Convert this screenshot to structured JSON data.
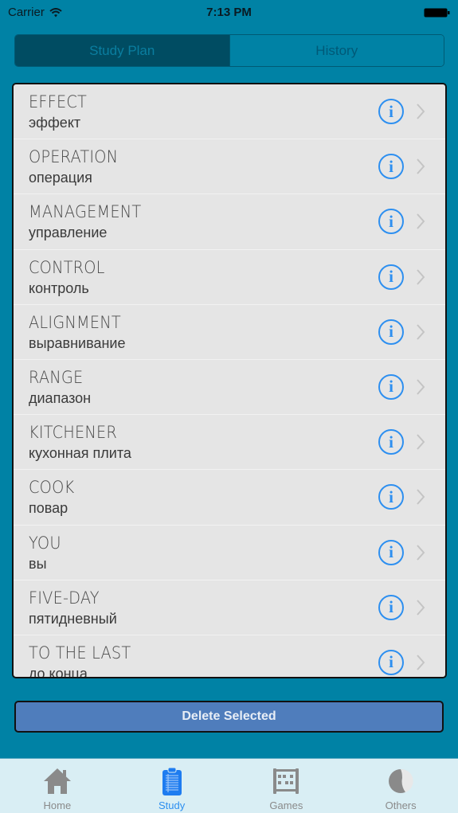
{
  "status_bar": {
    "carrier": "Carrier",
    "time": "7:13 PM",
    "wifi_icon": "wifi-icon",
    "battery_icon": "battery-icon"
  },
  "segmented_control": {
    "items": [
      {
        "label": "Study Plan",
        "selected": true
      },
      {
        "label": "History",
        "selected": false
      }
    ]
  },
  "word_list": {
    "items": [
      {
        "word": "EFFECT",
        "translation": "эффект"
      },
      {
        "word": "OPERATION",
        "translation": "операция"
      },
      {
        "word": "MANAGEMENT",
        "translation": "управление"
      },
      {
        "word": "CONTROL",
        "translation": "контроль"
      },
      {
        "word": "ALIGNMENT",
        "translation": "выравнивание"
      },
      {
        "word": "RANGE",
        "translation": "диапазон"
      },
      {
        "word": "KITCHENER",
        "translation": "кухонная плита"
      },
      {
        "word": "COOK",
        "translation": "повар"
      },
      {
        "word": "YOU",
        "translation": "вы"
      },
      {
        "word": "FIVE-DAY",
        "translation": "пятидневный"
      },
      {
        "word": "TO THE LAST",
        "translation": "до конца"
      }
    ],
    "info_icon_glyph": "i",
    "info_icon": "info-icon",
    "disclosure_icon": "chevron-right-icon"
  },
  "actions": {
    "delete_label": "Delete Selected"
  },
  "tab_bar": {
    "items": [
      {
        "label": "Home",
        "icon": "home-icon",
        "active": false
      },
      {
        "label": "Study",
        "icon": "clipboard-icon",
        "active": true
      },
      {
        "label": "Games",
        "icon": "abacus-icon",
        "active": false
      },
      {
        "label": "Others",
        "icon": "half-circle-icon",
        "active": false
      }
    ]
  },
  "colors": {
    "background": "#0082a5",
    "accent_blue": "#2d8ff0",
    "list_background": "#e5e5e5",
    "delete_button": "#4f7dbc",
    "tab_bar": "#d9eef4",
    "segment_active": "#004c62"
  }
}
